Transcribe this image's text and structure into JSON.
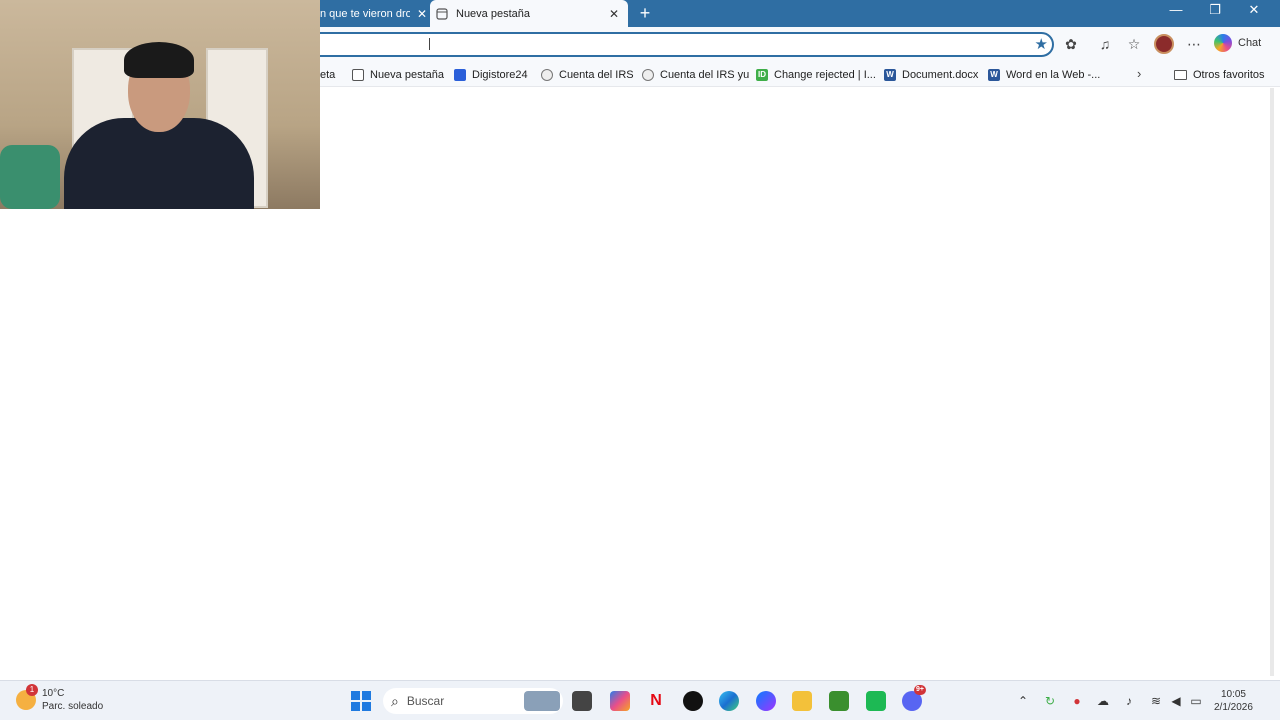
{
  "browser": {
    "tabs": [
      {
        "label": "n que te vieron drog",
        "active": false
      },
      {
        "label": "Nueva pestaña",
        "active": true
      }
    ],
    "new_tab_label": "+",
    "chat_label": "Chat",
    "window_controls": {
      "minimize": "—",
      "maximize": "❐",
      "close": "✕"
    },
    "accent_color": "#2f6ea3"
  },
  "favorites": {
    "items": [
      {
        "label": "eta",
        "icon": "page-icon"
      },
      {
        "label": "Nueva pestaña",
        "icon": "page-icon"
      },
      {
        "label": "Digistore24",
        "icon": "digistore-icon"
      },
      {
        "label": "Cuenta del IRS",
        "icon": "irs-icon"
      },
      {
        "label": "Cuenta del IRS yu",
        "icon": "irs-icon"
      },
      {
        "label": "Change rejected | I...",
        "icon": "id-icon",
        "glyph": "ID"
      },
      {
        "label": "Document.docx",
        "icon": "word-icon",
        "glyph": "W"
      },
      {
        "label": "Word en la Web -...",
        "icon": "word-icon",
        "glyph": "W"
      }
    ],
    "more_label": "›",
    "other_favorites_label": "Otros favoritos"
  },
  "taskbar": {
    "weather": {
      "temp": "10°C",
      "condition": "Parc. soleado",
      "badge": "1"
    },
    "search_label": "Buscar",
    "apps": [
      "file-explorer-thumbnail-icon",
      "task-view-icon",
      "copilot-icon",
      "netflix-icon",
      "tiktok-icon",
      "edge-icon",
      "messenger-icon",
      "folder-icon",
      "minecraft-icon",
      "app-icon",
      "discord-icon"
    ],
    "netflix_glyph": "N",
    "discord_badge": "9+",
    "clock": {
      "time": "10:05",
      "date": "2/1/2026"
    }
  }
}
